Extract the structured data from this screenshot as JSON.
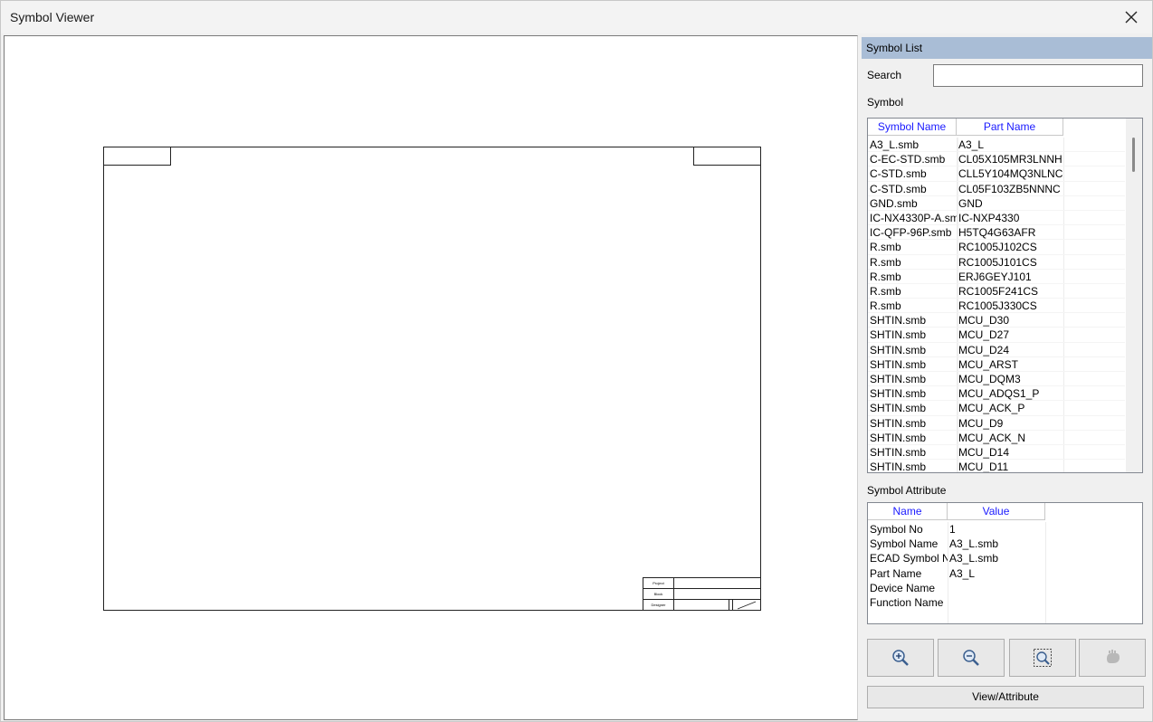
{
  "window": {
    "title": "Symbol Viewer"
  },
  "titleblock": {
    "project": "Project",
    "block": "Block",
    "designer": "Designer"
  },
  "panel": {
    "header": "Symbol List",
    "search_label": "Search",
    "search_value": "",
    "symbol_label": "Symbol",
    "attribute_label": "Symbol Attribute",
    "view_button": "View/Attribute"
  },
  "symbol_list": {
    "columns": [
      "Symbol Name",
      "Part Name"
    ],
    "rows": [
      {
        "symbol": "A3_L.smb",
        "part": "A3_L"
      },
      {
        "symbol": "C-EC-STD.smb",
        "part": "CL05X105MR3LNNH"
      },
      {
        "symbol": "C-STD.smb",
        "part": "CLL5Y104MQ3NLNC"
      },
      {
        "symbol": "C-STD.smb",
        "part": "CL05F103ZB5NNNC"
      },
      {
        "symbol": "GND.smb",
        "part": "GND"
      },
      {
        "symbol": "IC-NX4330P-A.sm",
        "part": "IC-NXP4330"
      },
      {
        "symbol": "IC-QFP-96P.smb",
        "part": "H5TQ4G63AFR"
      },
      {
        "symbol": "R.smb",
        "part": "RC1005J102CS"
      },
      {
        "symbol": "R.smb",
        "part": "RC1005J101CS"
      },
      {
        "symbol": "R.smb",
        "part": "ERJ6GEYJ101"
      },
      {
        "symbol": "R.smb",
        "part": "RC1005F241CS"
      },
      {
        "symbol": "R.smb",
        "part": "RC1005J330CS"
      },
      {
        "symbol": "SHTIN.smb",
        "part": "MCU_D30"
      },
      {
        "symbol": "SHTIN.smb",
        "part": "MCU_D27"
      },
      {
        "symbol": "SHTIN.smb",
        "part": "MCU_D24"
      },
      {
        "symbol": "SHTIN.smb",
        "part": "MCU_ARST"
      },
      {
        "symbol": "SHTIN.smb",
        "part": "MCU_DQM3"
      },
      {
        "symbol": "SHTIN.smb",
        "part": "MCU_ADQS1_P"
      },
      {
        "symbol": "SHTIN.smb",
        "part": "MCU_ACK_P"
      },
      {
        "symbol": "SHTIN.smb",
        "part": "MCU_D9"
      },
      {
        "symbol": "SHTIN.smb",
        "part": "MCU_ACK_N"
      },
      {
        "symbol": "SHTIN.smb",
        "part": "MCU_D14"
      },
      {
        "symbol": "SHTIN.smb",
        "part": "MCU_D11"
      }
    ]
  },
  "attributes": {
    "columns": [
      "Name",
      "Value"
    ],
    "rows": [
      {
        "name": "Symbol No",
        "value": "1"
      },
      {
        "name": "Symbol Name",
        "value": "A3_L.smb"
      },
      {
        "name": "ECAD Symbol N",
        "value": "A3_L.smb"
      },
      {
        "name": "Part Name",
        "value": "A3_L"
      },
      {
        "name": "Device Name",
        "value": ""
      },
      {
        "name": "Function Name",
        "value": ""
      }
    ]
  },
  "toolbar": {
    "zoom_in_icon": "zoom-in-icon",
    "zoom_out_icon": "zoom-out-icon",
    "zoom_fit_icon": "zoom-fit-icon",
    "pan_icon": "hand-icon"
  },
  "colors": {
    "header_bg": "#a9bdd6",
    "column_header_text": "#1a1aff"
  }
}
